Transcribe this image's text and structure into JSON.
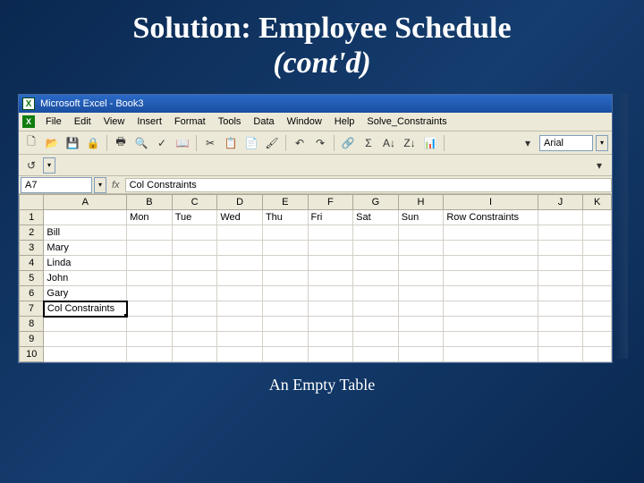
{
  "slide": {
    "title_line1": "Solution: Employee Schedule",
    "title_line2": "(cont'd)",
    "caption": "An Empty Table"
  },
  "app": {
    "titlebar": "Microsoft Excel - Book3",
    "menus": [
      "File",
      "Edit",
      "View",
      "Insert",
      "Format",
      "Tools",
      "Data",
      "Window",
      "Help",
      "Solve_Constraints"
    ],
    "font_name": "Arial"
  },
  "namebox": "A7",
  "formula": "Col Constraints",
  "columns": [
    "A",
    "B",
    "C",
    "D",
    "E",
    "F",
    "G",
    "H",
    "I",
    "J",
    "K"
  ],
  "rows": [
    {
      "n": "1",
      "cells": [
        "",
        "Mon",
        "Tue",
        "Wed",
        "Thu",
        "Fri",
        "Sat",
        "Sun",
        "Row Constraints",
        "",
        ""
      ]
    },
    {
      "n": "2",
      "cells": [
        "Bill",
        "",
        "",
        "",
        "",
        "",
        "",
        "",
        "",
        "",
        ""
      ]
    },
    {
      "n": "3",
      "cells": [
        "Mary",
        "",
        "",
        "",
        "",
        "",
        "",
        "",
        "",
        "",
        ""
      ]
    },
    {
      "n": "4",
      "cells": [
        "Linda",
        "",
        "",
        "",
        "",
        "",
        "",
        "",
        "",
        "",
        ""
      ]
    },
    {
      "n": "5",
      "cells": [
        "John",
        "",
        "",
        "",
        "",
        "",
        "",
        "",
        "",
        "",
        ""
      ]
    },
    {
      "n": "6",
      "cells": [
        "Gary",
        "",
        "",
        "",
        "",
        "",
        "",
        "",
        "",
        "",
        ""
      ]
    },
    {
      "n": "7",
      "cells": [
        "Col Constraints",
        "",
        "",
        "",
        "",
        "",
        "",
        "",
        "",
        "",
        ""
      ]
    },
    {
      "n": "8",
      "cells": [
        "",
        "",
        "",
        "",
        "",
        "",
        "",
        "",
        "",
        "",
        ""
      ]
    },
    {
      "n": "9",
      "cells": [
        "",
        "",
        "",
        "",
        "",
        "",
        "",
        "",
        "",
        "",
        ""
      ]
    },
    {
      "n": "10",
      "cells": [
        "",
        "",
        "",
        "",
        "",
        "",
        "",
        "",
        "",
        "",
        ""
      ]
    }
  ],
  "selected": {
    "row": "7",
    "col": "A"
  }
}
